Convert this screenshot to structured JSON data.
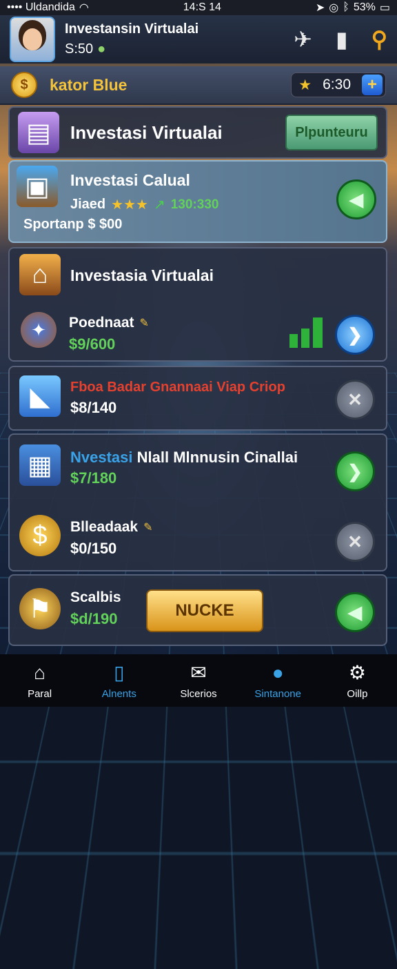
{
  "status": {
    "left": "•••• Uldandida",
    "wifi_icon": "wifi-icon",
    "time": "14:S 14",
    "battery": "53%"
  },
  "header": {
    "title": "Investansin Virtualai",
    "subtitle": "S:50"
  },
  "resource": {
    "name": "kator Blue",
    "value": "6:30"
  },
  "top_card": {
    "title": "Investasi Virtualai",
    "button": "Plpunteuru"
  },
  "featured": {
    "title": "Investasi Calual",
    "label": "Jiaed",
    "stat": "130:330",
    "sub": "Sportanp $ $00"
  },
  "card2": {
    "title": "Investasia Virtualai",
    "item": "Poednaat",
    "value": "$9/600"
  },
  "card3": {
    "title": "Fboa Badar Gnannaai Viap Criop",
    "value": "$8/140"
  },
  "card4": {
    "title_blue": "Nvestasi",
    "title_white": "Nlall Mlnnusin Cinallai",
    "value": "$7/180"
  },
  "card5": {
    "title": "Blleadaak",
    "value": "$0/150"
  },
  "card6": {
    "title": "Scalbis",
    "value": "$d/190",
    "button": "NUCKE"
  },
  "tabs": [
    {
      "label": "Paral",
      "icon": "home-icon"
    },
    {
      "label": "Alnents",
      "icon": "clipboard-icon"
    },
    {
      "label": "Slcerios",
      "icon": "mail-icon"
    },
    {
      "label": "Sintanone",
      "icon": "bomb-icon"
    },
    {
      "label": "Oillp",
      "icon": "gear-icon"
    }
  ],
  "colors": {
    "accent_gold": "#f4c33c",
    "value_green": "#62d25a",
    "accent_blue": "#3aa3e8",
    "alert_red": "#e6402e"
  }
}
